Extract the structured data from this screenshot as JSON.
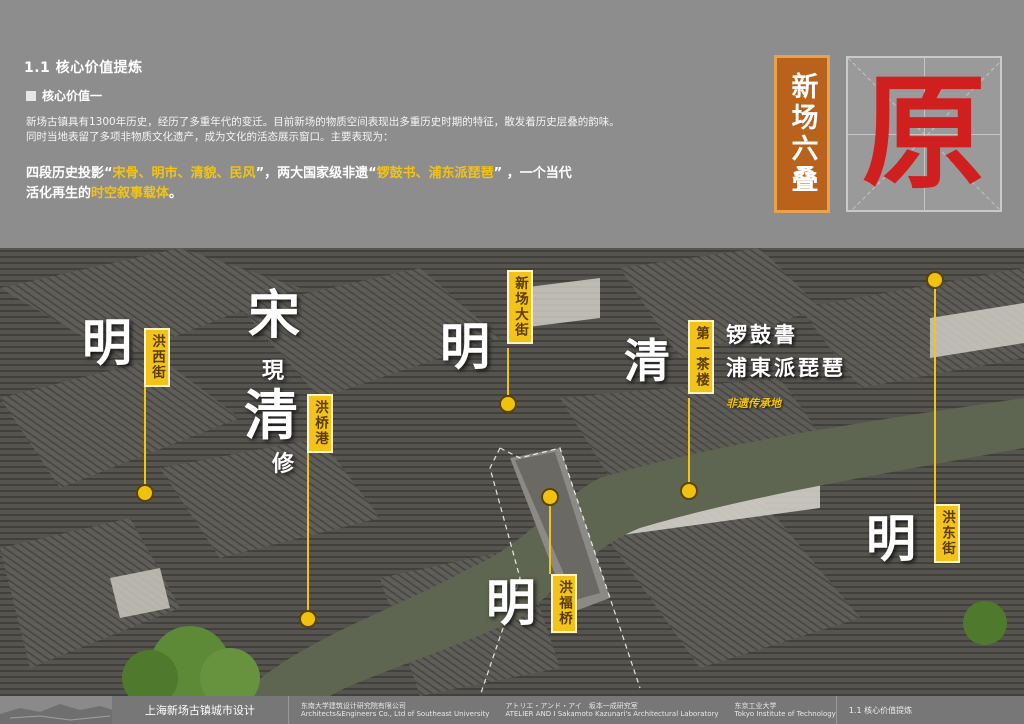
{
  "header": {
    "section_title": "1.1 核心价值提炼",
    "subsection_title": "核心价值一",
    "paragraph_line1": "新场古镇具有1300年历史，经历了多重年代的变迁。目前新场的物质空间表现出多重历史时期的特征，散发着历史层叠的韵味。",
    "paragraph_line2": "同时当地表留了多项非物质文化遗产，成为文化的活态展示窗口。主要表现为：",
    "highlight": {
      "p1": "四段历史投影“",
      "h1": "宋骨、明市、清貌、民风",
      "p2": "”，两大国家级非遗“",
      "h2": "锣鼓书、浦东派琵琶",
      "p3": "” ，一个当代",
      "p4": "活化再生的",
      "h3": "时空叙事载体",
      "p5": "。"
    },
    "badge_text": "新场六叠",
    "big_char": "原"
  },
  "photo": {
    "calligraphy": {
      "ming_left": "明",
      "song": "宋",
      "xian": "現",
      "qing_left": "清",
      "xiu": "修",
      "ming_center": "明",
      "qing_right": "清",
      "ming_bottom": "明",
      "ming_right": "明"
    },
    "tags": {
      "hongxi": "洪西街",
      "xinchang": "新场大街",
      "hongqiao": "洪桥港",
      "teahouse": "第一茶楼",
      "hongfu": "洪福桥",
      "hongdong": "洪东街"
    },
    "heritage": {
      "line1": "锣鼓書",
      "line2": "浦東派琵琶",
      "sub": "非遗传承地"
    }
  },
  "footer": {
    "project": "上海新场古镇城市设计",
    "inst1_cn": "东南大学建筑设计研究院有限公司",
    "inst1_en": "Architects&Engineers Co., Ltd of Southeast University",
    "inst2_cn": "アトリエ・アンド・アイ　坂本一成研究室",
    "inst2_en": "ATELIER AND I Sakamoto Kazunari's Architectural Laboratory",
    "inst3_cn": "东京工业大学",
    "inst3_en": "Tokyo Institute of Technology",
    "page_label": "1.1 核心价值提炼"
  },
  "colors": {
    "accent_yellow": "#f2c31a",
    "badge_brown": "#b8621c",
    "seal_red": "#cf1f1f"
  }
}
